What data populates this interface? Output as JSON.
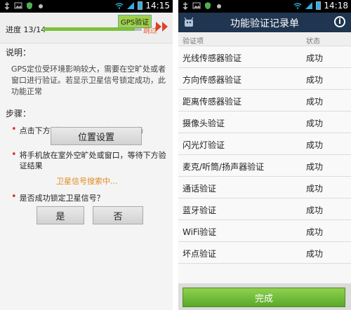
{
  "left": {
    "status_time": "14:15",
    "progress_label": "进度 13/14",
    "progress_fraction": 0.93,
    "current_tag": "GPS验证",
    "skip_label": "跳过",
    "desc_title": "说明：",
    "desc_text": "GPS定位受环境影响较大，需要在空旷处或者窗口进行验证。若显示卫星信号锁定成功，此功能正常",
    "steps_title": "步骤：",
    "step1": "点击下方“位置设置”，开启GPS服务",
    "location_button": "位置设置",
    "step2": "将手机放在室外空旷处或窗口，等待下方验证结果",
    "searching": "卫星信号搜索中...",
    "step3": "是否成功锁定卫星信号？",
    "yes_button": "是",
    "no_button": "否"
  },
  "right": {
    "status_time": "14:18",
    "title": "功能验证记录单",
    "col_item": "验证项",
    "col_status": "状态",
    "rows": [
      {
        "name": "光线传感器验证",
        "status": "成功"
      },
      {
        "name": "方向传感器验证",
        "status": "成功"
      },
      {
        "name": "距离传感器验证",
        "status": "成功"
      },
      {
        "name": "摄像头验证",
        "status": "成功"
      },
      {
        "name": "闪光灯验证",
        "status": "成功"
      },
      {
        "name": "麦克/听筒/扬声器验证",
        "status": "成功"
      },
      {
        "name": "通话验证",
        "status": "成功"
      },
      {
        "name": "蓝牙验证",
        "status": "成功"
      },
      {
        "name": "WiFi验证",
        "status": "成功"
      },
      {
        "name": "坏点验证",
        "status": "成功"
      }
    ],
    "done_button": "完成"
  },
  "colors": {
    "title_bar": "#1f3550",
    "progress_fill": "#7cc03a",
    "accent_orange": "#e08a1e",
    "done_green": "#6cbc35"
  }
}
